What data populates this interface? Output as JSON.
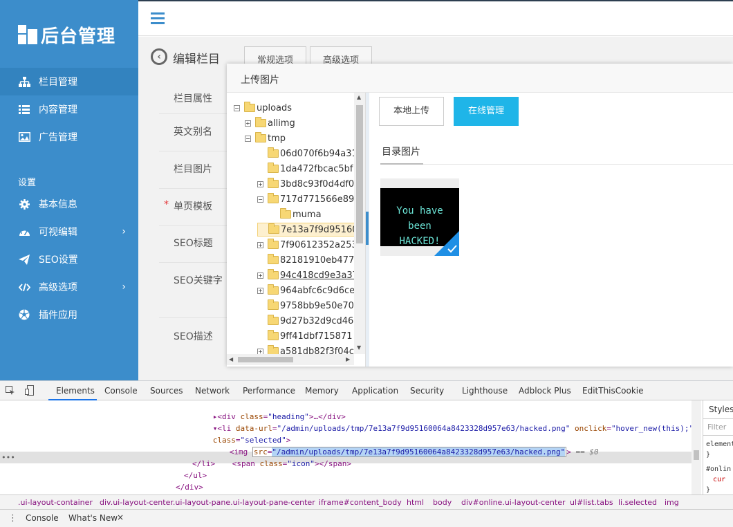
{
  "sidebar": {
    "logo_text": "后台管理",
    "items": [
      {
        "label": "栏目管理",
        "icon": "sitemap-icon"
      },
      {
        "label": "内容管理",
        "icon": "list-icon"
      },
      {
        "label": "广告管理",
        "icon": "image-icon"
      }
    ],
    "section_label": "设置",
    "settings": [
      {
        "label": "基本信息",
        "icon": "gear-icon"
      },
      {
        "label": "可视编辑",
        "icon": "dashboard-icon",
        "chevron": "›"
      },
      {
        "label": "SEO设置",
        "icon": "send-icon"
      },
      {
        "label": "高级选项",
        "icon": "code-icon",
        "chevron": "›"
      },
      {
        "label": "插件应用",
        "icon": "soccer-icon"
      }
    ]
  },
  "main": {
    "title": "编辑栏目",
    "tabs": [
      "常规选项",
      "高级选项"
    ],
    "form_labels": [
      "栏目属性",
      "英文别名",
      "栏目图片",
      "单页模板",
      "SEO标题",
      "SEO关键字",
      "SEO描述"
    ],
    "required_mark": "*"
  },
  "modal": {
    "title": "上传图片",
    "tree": {
      "root": "uploads",
      "nodes": [
        {
          "label": "allimg",
          "exp": "+"
        },
        {
          "label": "tmp",
          "exp": "−"
        },
        {
          "label": "06d070f6b94a31",
          "exp": ""
        },
        {
          "label": "1da472fbcac5bf",
          "exp": ""
        },
        {
          "label": "3bd8c93f0d4df0",
          "exp": "+"
        },
        {
          "label": "717d771566e89",
          "exp": "−"
        },
        {
          "label": "muma",
          "exp": ""
        },
        {
          "label": "7e13a7f9d95160",
          "exp": ""
        },
        {
          "label": "7f90612352a253",
          "exp": "+"
        },
        {
          "label": "82181910eb477",
          "exp": ""
        },
        {
          "label": "94c418cd9e3a37",
          "exp": "+"
        },
        {
          "label": "964abfc6c9d6ce",
          "exp": "+"
        },
        {
          "label": "9758bb9e50e70",
          "exp": ""
        },
        {
          "label": "9d27b32d9cd46",
          "exp": ""
        },
        {
          "label": "9ff41dbf715871",
          "exp": ""
        },
        {
          "label": "a581db82f3f04c",
          "exp": "+"
        }
      ]
    },
    "buttons": {
      "local": "本地上传",
      "online": "在线管理"
    },
    "dir_title": "目录图片",
    "thumb_text_1": "You have been",
    "thumb_text_2": "HACKED!"
  },
  "devtools": {
    "tabs": [
      "Elements",
      "Console",
      "Sources",
      "Network",
      "Performance",
      "Memory",
      "Application",
      "Security",
      "Lighthouse",
      "Adblock Plus",
      "EditThisCookie"
    ],
    "code": {
      "l1_tag_open": "▸<div ",
      "l1_attr": "class",
      "l1_val": "\"heading\"",
      "l1_rest": ">…</div>",
      "l2_tag": "▾<li ",
      "l2_attr1": "data-url",
      "l2_val1": "\"/admin/uploads/tmp/7e13a7f9d95160064a8423328d957e63/hacked.png\"",
      "l2_attr2": " onclick",
      "l2_val2": "\"hover_new(this);\"",
      "l3_attr": "class",
      "l3_val": "\"selected\"",
      "l3_close": ">",
      "l4_tag": "<img ",
      "l4_attr": "src",
      "l4_val": "\"/admin/uploads/tmp/7e13a7f9d95160064a8423328d957e63/hacked.png\"",
      "l4_close": ">",
      "l4_eq": " == $0",
      "l5_tag": "<span ",
      "l5_attr": "class",
      "l5_val": "\"icon\"",
      "l5_close": "></span>",
      "l6": "</li>",
      "l7": "</ul>",
      "l8": "</div>"
    },
    "styles_tab": "Styles",
    "filter_placeholder": "Filter",
    "styles_lines": [
      "element",
      "}",
      "#onlin",
      "cur",
      "}"
    ],
    "breadcrumbs": [
      ".ui-layout-container",
      "div.ui-layout-center.ui-layout-pane.ui-layout-pane-center",
      "iframe#content_body",
      "html",
      "body",
      "div#online.ui-layout-center",
      "ul#list.tabs",
      "li.selected",
      "img"
    ],
    "bottom_tabs": [
      "Console",
      "What's New"
    ],
    "close_glyph": "×",
    "menu_glyph": "⋮"
  }
}
